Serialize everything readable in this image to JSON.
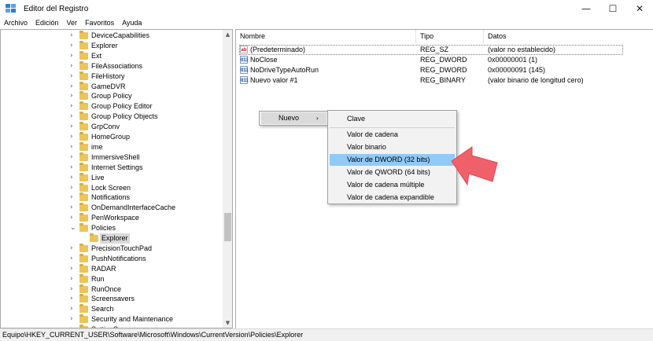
{
  "window": {
    "title": "Editor del Registro",
    "icon": "registry-editor-icon",
    "controls": {
      "minimize": "—",
      "maximize": "☐",
      "close": "✕"
    }
  },
  "menubar": {
    "items": [
      "Archivo",
      "Edición",
      "Ver",
      "Favoritos",
      "Ayuda"
    ]
  },
  "tree": {
    "items": [
      "DeviceCapabilities",
      "Explorer",
      "Ext",
      "FileAssociations",
      "FileHistory",
      "GameDVR",
      "Group Policy",
      "Group Policy Editor",
      "Group Policy Objects",
      "GrpConv",
      "HomeGroup",
      "ime",
      "ImmersiveShell",
      "Internet Settings",
      "Live",
      "Lock Screen",
      "Notifications",
      "OnDemandInterfaceCache",
      "PenWorkspace",
      "Policies",
      "Explorer",
      "PrecisionTouchPad",
      "PushNotifications",
      "RADAR",
      "Run",
      "RunOnce",
      "Screensavers",
      "Search",
      "Security and Maintenance",
      "SettingSync"
    ],
    "expanded_item": "Policies",
    "selected_item": "Explorer",
    "chevron_collapsed": "›",
    "chevron_expanded": "⌄",
    "folder_color": "#ecc45a",
    "scroll_up": "▲",
    "scroll_down": "▼"
  },
  "list": {
    "headers": {
      "name": "Nombre",
      "type": "Tipo",
      "data": "Datos"
    },
    "rows": [
      {
        "icon": "string-value-icon",
        "badge": "ab",
        "name": "(Predeterminado)",
        "type": "REG_SZ",
        "data": "(valor no establecido)"
      },
      {
        "icon": "binary-value-icon",
        "badge": "011",
        "name": "NoClose",
        "type": "REG_DWORD",
        "data": "0x00000001 (1)"
      },
      {
        "icon": "binary-value-icon",
        "badge": "011",
        "name": "NoDriveTypeAutoRun",
        "type": "REG_DWORD",
        "data": "0x00000091 (145)"
      },
      {
        "icon": "binary-value-icon",
        "badge": "011",
        "name": "Nuevo valor #1",
        "type": "REG_BINARY",
        "data": "(valor binario de longitud cero)"
      }
    ]
  },
  "context_menu": {
    "parent_label": "Nuevo",
    "parent_arrow": "›",
    "submenu": [
      "Clave",
      "Valor de cadena",
      "Valor binario",
      "Valor de DWORD (32 bits)",
      "Valor de QWORD (64 bits)",
      "Valor de cadena múltiple",
      "Valor de cadena expandible"
    ],
    "highlighted": "Valor de DWORD (32 bits)",
    "highlight_color": "#91c9f7"
  },
  "annotation": {
    "icon": "pointer-arrow-icon",
    "color": "#f0606a"
  },
  "statusbar": {
    "path": "Equipo\\HKEY_CURRENT_USER\\Software\\Microsoft\\Windows\\CurrentVersion\\Policies\\Explorer"
  }
}
